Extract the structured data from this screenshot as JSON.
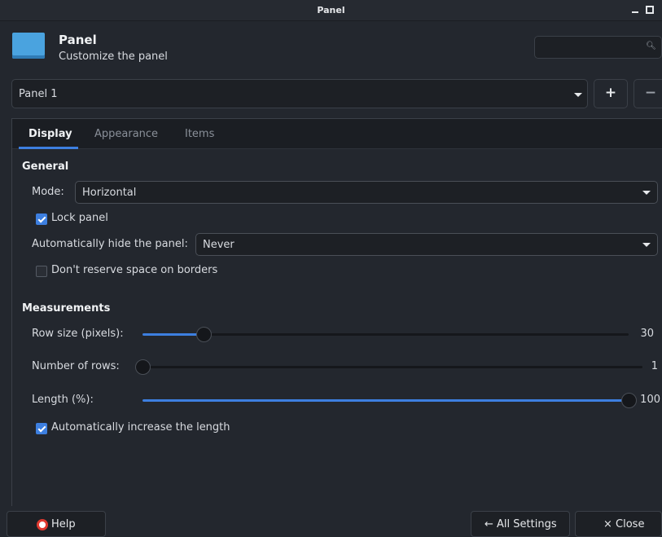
{
  "window": {
    "title": "Panel"
  },
  "header": {
    "title": "Panel",
    "subtitle": "Customize the panel",
    "search_icon": "search-icon"
  },
  "panel_selector": {
    "value": "Panel 1",
    "add_label": "+",
    "remove_label": "−"
  },
  "tabs": [
    {
      "label": "Display",
      "active": true
    },
    {
      "label": "Appearance",
      "active": false
    },
    {
      "label": "Items",
      "active": false
    }
  ],
  "general": {
    "heading": "General",
    "mode_label": "Mode:",
    "mode_value": "Horizontal",
    "lock_panel_label": "Lock panel",
    "lock_panel_checked": true,
    "autohide_label": "Automatically hide the panel:",
    "autohide_value": "Never",
    "reserve_label": "Don't reserve space on borders",
    "reserve_checked": false
  },
  "measurements": {
    "heading": "Measurements",
    "row_size_label": "Row size (pixels):",
    "row_size_value": "30",
    "rows_label": "Number of rows:",
    "rows_value": "1",
    "length_label": "Length (%):",
    "length_value": "100",
    "auto_increase_label": "Automatically increase the length",
    "auto_increase_checked": true
  },
  "footer": {
    "help_label": "Help",
    "all_settings_label": "← All Settings",
    "close_label": "× Close"
  },
  "colors": {
    "accent": "#3d7fe0",
    "background": "#23272e",
    "help_icon": "#e0392f"
  }
}
